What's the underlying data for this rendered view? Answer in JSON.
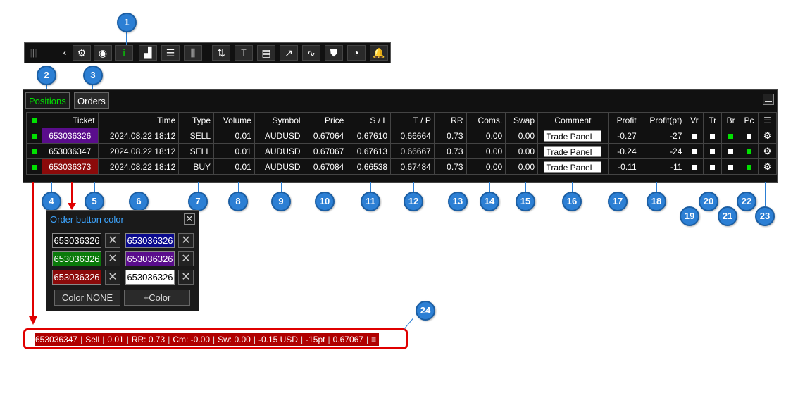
{
  "toolbar": {
    "buttons": [
      "back-icon",
      "gear-icon",
      "camera-icon",
      "info-icon",
      "bar-chart-icon",
      "list-icon",
      "candlestick-icon",
      "trade-icon",
      "range-icon",
      "document-icon",
      "trend-up-icon",
      "trend-line-icon",
      "shield-icon",
      "pie-icon",
      "bell-icon"
    ],
    "glyphs": [
      "‹",
      "⚙",
      "◉",
      "i",
      "▟",
      "☰",
      "⫼",
      "⇅",
      "⌶",
      "▤",
      "↗",
      "∿",
      "⛊",
      "◔",
      "🔔"
    ]
  },
  "callouts": [
    "1",
    "2",
    "3",
    "4",
    "5",
    "6",
    "7",
    "8",
    "9",
    "10",
    "11",
    "12",
    "13",
    "14",
    "15",
    "16",
    "17",
    "18",
    "19",
    "20",
    "21",
    "22",
    "23",
    "24"
  ],
  "panel": {
    "tabs": {
      "positions": "Positions",
      "orders": "Orders"
    },
    "headers": [
      "Ticket",
      "Time",
      "Type",
      "Volume",
      "Symbol",
      "Price",
      "S / L",
      "T / P",
      "RR",
      "Coms.",
      "Swap",
      "Comment",
      "Profit",
      "Profit(pt)",
      "Vr",
      "Tr",
      "Br",
      "Pc"
    ],
    "rows": [
      {
        "ticket": "653036326",
        "ticket_color": "#5a0d8c",
        "time": "2024.08.22 18:12",
        "type": "SELL",
        "volume": "0.01",
        "symbol": "AUDUSD",
        "price": "0.67064",
        "sl": "0.67610",
        "tp": "0.66664",
        "rr": "0.73",
        "coms": "0.00",
        "swap": "0.00",
        "comment": "Trade Panel",
        "profit": "-0.27",
        "profit_pt": "-27",
        "vr": "white",
        "tr": "white",
        "br": "green",
        "pc": "white"
      },
      {
        "ticket": "653036347",
        "ticket_color": "#111111",
        "time": "2024.08.22 18:12",
        "type": "SELL",
        "volume": "0.01",
        "symbol": "AUDUSD",
        "price": "0.67067",
        "sl": "0.67613",
        "tp": "0.66667",
        "rr": "0.73",
        "coms": "0.00",
        "swap": "0.00",
        "comment": "Trade Panel",
        "profit": "-0.24",
        "profit_pt": "-24",
        "vr": "white",
        "tr": "white",
        "br": "white",
        "pc": "green"
      },
      {
        "ticket": "653036373",
        "ticket_color": "#8b0a0a",
        "time": "2024.08.22 18:12",
        "type": "BUY",
        "volume": "0.01",
        "symbol": "AUDUSD",
        "price": "0.67084",
        "sl": "0.66538",
        "tp": "0.67484",
        "rr": "0.73",
        "coms": "0.00",
        "swap": "0.00",
        "comment": "Trade Panel",
        "profit": "-0.11",
        "profit_pt": "-11",
        "vr": "white",
        "tr": "white",
        "br": "white",
        "pc": "green"
      }
    ]
  },
  "popup": {
    "title": "Order button color",
    "swatches": [
      {
        "text": "653036326",
        "bg": "#111111"
      },
      {
        "text": "653036326",
        "bg": "#0a0a8c"
      },
      {
        "text": "653036326",
        "bg": "#0a7a0a"
      },
      {
        "text": "653036326",
        "bg": "#5a0d8c"
      },
      {
        "text": "653036326",
        "bg": "#8b0a0a"
      },
      {
        "text": "653036326",
        "bg": "#ffffff"
      }
    ],
    "color_none": "Color NONE",
    "add_color": "+Color"
  },
  "order_line": {
    "items": [
      "653036347",
      "Sell",
      "0.01",
      "RR: 0.73",
      "Cm: -0.00",
      "Sw: 0.00",
      "-0.15 USD",
      "-15pt",
      "0.67067"
    ],
    "menu": "≡"
  },
  "colors": {
    "accent": "#2c7fd4",
    "highlight": "#e00000",
    "profit_green": "#00e000"
  }
}
